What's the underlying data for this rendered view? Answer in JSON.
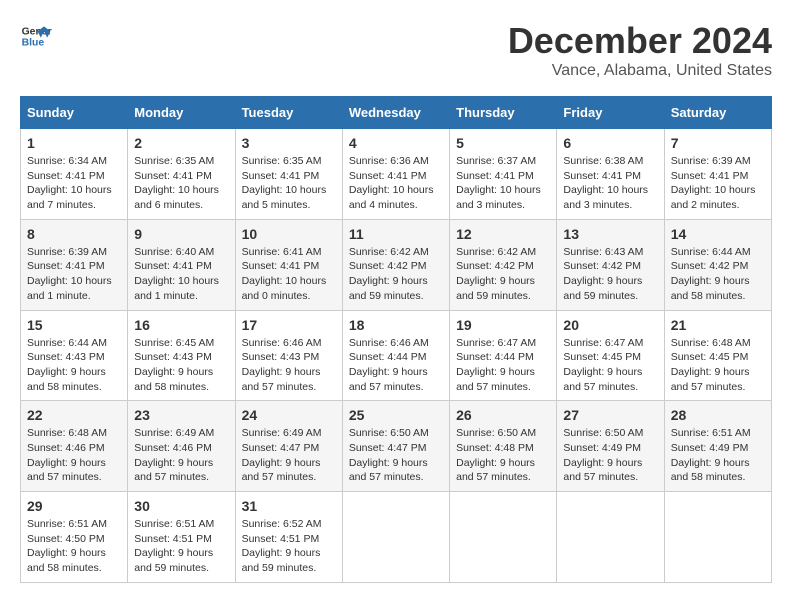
{
  "logo": {
    "line1": "General",
    "line2": "Blue"
  },
  "title": "December 2024",
  "location": "Vance, Alabama, United States",
  "days_of_week": [
    "Sunday",
    "Monday",
    "Tuesday",
    "Wednesday",
    "Thursday",
    "Friday",
    "Saturday"
  ],
  "weeks": [
    [
      {
        "day": "1",
        "sunrise": "6:34 AM",
        "sunset": "4:41 PM",
        "daylight": "10 hours and 7 minutes."
      },
      {
        "day": "2",
        "sunrise": "6:35 AM",
        "sunset": "4:41 PM",
        "daylight": "10 hours and 6 minutes."
      },
      {
        "day": "3",
        "sunrise": "6:35 AM",
        "sunset": "4:41 PM",
        "daylight": "10 hours and 5 minutes."
      },
      {
        "day": "4",
        "sunrise": "6:36 AM",
        "sunset": "4:41 PM",
        "daylight": "10 hours and 4 minutes."
      },
      {
        "day": "5",
        "sunrise": "6:37 AM",
        "sunset": "4:41 PM",
        "daylight": "10 hours and 3 minutes."
      },
      {
        "day": "6",
        "sunrise": "6:38 AM",
        "sunset": "4:41 PM",
        "daylight": "10 hours and 3 minutes."
      },
      {
        "day": "7",
        "sunrise": "6:39 AM",
        "sunset": "4:41 PM",
        "daylight": "10 hours and 2 minutes."
      }
    ],
    [
      {
        "day": "8",
        "sunrise": "6:39 AM",
        "sunset": "4:41 PM",
        "daylight": "10 hours and 1 minute."
      },
      {
        "day": "9",
        "sunrise": "6:40 AM",
        "sunset": "4:41 PM",
        "daylight": "10 hours and 1 minute."
      },
      {
        "day": "10",
        "sunrise": "6:41 AM",
        "sunset": "4:41 PM",
        "daylight": "10 hours and 0 minutes."
      },
      {
        "day": "11",
        "sunrise": "6:42 AM",
        "sunset": "4:42 PM",
        "daylight": "9 hours and 59 minutes."
      },
      {
        "day": "12",
        "sunrise": "6:42 AM",
        "sunset": "4:42 PM",
        "daylight": "9 hours and 59 minutes."
      },
      {
        "day": "13",
        "sunrise": "6:43 AM",
        "sunset": "4:42 PM",
        "daylight": "9 hours and 59 minutes."
      },
      {
        "day": "14",
        "sunrise": "6:44 AM",
        "sunset": "4:42 PM",
        "daylight": "9 hours and 58 minutes."
      }
    ],
    [
      {
        "day": "15",
        "sunrise": "6:44 AM",
        "sunset": "4:43 PM",
        "daylight": "9 hours and 58 minutes."
      },
      {
        "day": "16",
        "sunrise": "6:45 AM",
        "sunset": "4:43 PM",
        "daylight": "9 hours and 58 minutes."
      },
      {
        "day": "17",
        "sunrise": "6:46 AM",
        "sunset": "4:43 PM",
        "daylight": "9 hours and 57 minutes."
      },
      {
        "day": "18",
        "sunrise": "6:46 AM",
        "sunset": "4:44 PM",
        "daylight": "9 hours and 57 minutes."
      },
      {
        "day": "19",
        "sunrise": "6:47 AM",
        "sunset": "4:44 PM",
        "daylight": "9 hours and 57 minutes."
      },
      {
        "day": "20",
        "sunrise": "6:47 AM",
        "sunset": "4:45 PM",
        "daylight": "9 hours and 57 minutes."
      },
      {
        "day": "21",
        "sunrise": "6:48 AM",
        "sunset": "4:45 PM",
        "daylight": "9 hours and 57 minutes."
      }
    ],
    [
      {
        "day": "22",
        "sunrise": "6:48 AM",
        "sunset": "4:46 PM",
        "daylight": "9 hours and 57 minutes."
      },
      {
        "day": "23",
        "sunrise": "6:49 AM",
        "sunset": "4:46 PM",
        "daylight": "9 hours and 57 minutes."
      },
      {
        "day": "24",
        "sunrise": "6:49 AM",
        "sunset": "4:47 PM",
        "daylight": "9 hours and 57 minutes."
      },
      {
        "day": "25",
        "sunrise": "6:50 AM",
        "sunset": "4:47 PM",
        "daylight": "9 hours and 57 minutes."
      },
      {
        "day": "26",
        "sunrise": "6:50 AM",
        "sunset": "4:48 PM",
        "daylight": "9 hours and 57 minutes."
      },
      {
        "day": "27",
        "sunrise": "6:50 AM",
        "sunset": "4:49 PM",
        "daylight": "9 hours and 57 minutes."
      },
      {
        "day": "28",
        "sunrise": "6:51 AM",
        "sunset": "4:49 PM",
        "daylight": "9 hours and 58 minutes."
      }
    ],
    [
      {
        "day": "29",
        "sunrise": "6:51 AM",
        "sunset": "4:50 PM",
        "daylight": "9 hours and 58 minutes."
      },
      {
        "day": "30",
        "sunrise": "6:51 AM",
        "sunset": "4:51 PM",
        "daylight": "9 hours and 59 minutes."
      },
      {
        "day": "31",
        "sunrise": "6:52 AM",
        "sunset": "4:51 PM",
        "daylight": "9 hours and 59 minutes."
      },
      null,
      null,
      null,
      null
    ]
  ]
}
